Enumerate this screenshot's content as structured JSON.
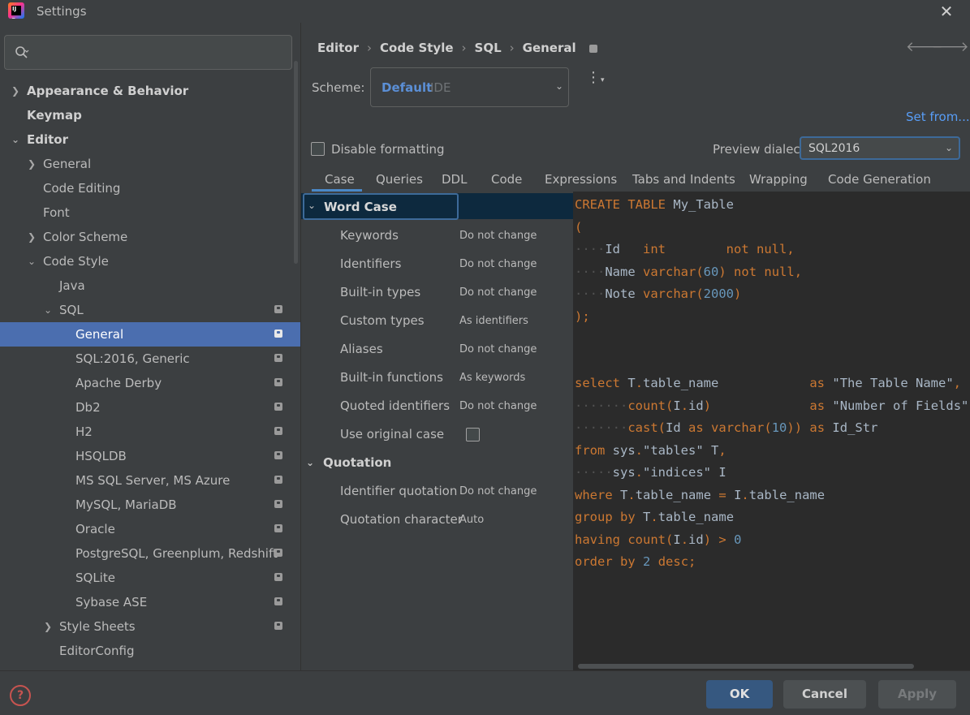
{
  "window": {
    "title": "Settings"
  },
  "sidebar": {
    "search_placeholder": "",
    "items": [
      {
        "label": "Appearance & Behavior"
      },
      {
        "label": "Keymap"
      },
      {
        "label": "Editor"
      },
      {
        "label": "General"
      },
      {
        "label": "Code Editing"
      },
      {
        "label": "Font"
      },
      {
        "label": "Color Scheme"
      },
      {
        "label": "Code Style"
      },
      {
        "label": "Java"
      },
      {
        "label": "SQL"
      },
      {
        "label": "General"
      },
      {
        "label": "SQL:2016, Generic"
      },
      {
        "label": "Apache Derby"
      },
      {
        "label": "Db2"
      },
      {
        "label": "H2"
      },
      {
        "label": "HSQLDB"
      },
      {
        "label": "MS SQL Server, MS Azure"
      },
      {
        "label": "MySQL, MariaDB"
      },
      {
        "label": "Oracle"
      },
      {
        "label": "PostgreSQL, Greenplum, Redshift"
      },
      {
        "label": "SQLite"
      },
      {
        "label": "Sybase ASE"
      },
      {
        "label": "Style Sheets"
      },
      {
        "label": "EditorConfig"
      }
    ]
  },
  "breadcrumb": {
    "items": [
      "Editor",
      "Code Style",
      "SQL",
      "General"
    ]
  },
  "scheme": {
    "label": "Scheme:",
    "name": "Default",
    "type": "IDE",
    "set_from": "Set from..."
  },
  "formatting": {
    "disable_label": "Disable formatting",
    "preview_label": "Preview dialect:",
    "dialect": "SQL2016"
  },
  "tabs": [
    "Case",
    "Queries",
    "DDL",
    "Code",
    "Expressions",
    "Tabs and Indents",
    "Wrapping",
    "Code Generation"
  ],
  "options": {
    "word_case": {
      "title": "Word Case",
      "rows": [
        {
          "name": "Keywords",
          "value": "Do not change"
        },
        {
          "name": "Identifiers",
          "value": "Do not change"
        },
        {
          "name": "Built-in types",
          "value": "Do not change"
        },
        {
          "name": "Custom types",
          "value": "As identifiers"
        },
        {
          "name": "Aliases",
          "value": "Do not change"
        },
        {
          "name": "Built-in functions",
          "value": "As keywords"
        },
        {
          "name": "Quoted identifiers",
          "value": "Do not change"
        },
        {
          "name": "Use original case",
          "value": ""
        }
      ]
    },
    "quotation": {
      "title": "Quotation",
      "rows": [
        {
          "name": "Identifier quotation",
          "value": "Do not change"
        },
        {
          "name": "Quotation character",
          "value": "Auto"
        }
      ]
    }
  },
  "code_preview": {
    "lines": [
      "CREATE TABLE My_Table",
      "(",
      "    Id   int        not null,",
      "    Name varchar(60) not null,",
      "    Note varchar(2000)",
      ");",
      "",
      "",
      "select T.table_name            as \"The Table Name\",",
      "       count(I.id)             as \"Number of Fields\",",
      "       cast(Id as varchar(10)) as Id_Str",
      "from sys.\"tables\" T,",
      "     sys.\"indices\" I",
      "where T.table_name = I.table_name",
      "group by T.table_name",
      "having count(I.id) > 0",
      "order by 2 desc;"
    ]
  },
  "buttons": {
    "ok": "OK",
    "cancel": "Cancel",
    "apply": "Apply",
    "help": "?"
  },
  "colors": {
    "accent": "#4b6eaf",
    "keyword": "#cc7832",
    "number": "#6897bb",
    "link": "#589df6"
  }
}
